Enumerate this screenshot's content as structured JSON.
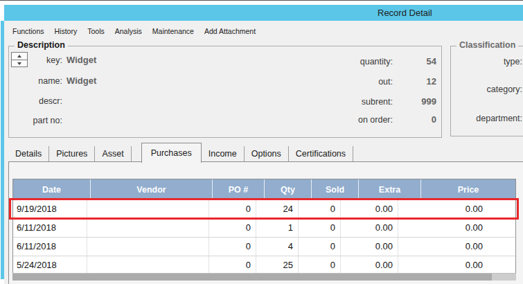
{
  "window": {
    "title": "Record Detail"
  },
  "menu": {
    "items": [
      "Functions",
      "History",
      "Tools",
      "Analysis",
      "Maintenance",
      "Add Attachment"
    ]
  },
  "description_panel": {
    "legend": "Description",
    "fields_left": [
      {
        "label": "key:",
        "value": "Widget"
      },
      {
        "label": "name:",
        "value": "Widget"
      },
      {
        "label": "descr:",
        "value": ""
      },
      {
        "label": "part no:",
        "value": ""
      }
    ],
    "fields_right": [
      {
        "label": "quantity:",
        "value": "54"
      },
      {
        "label": "out:",
        "value": "12"
      },
      {
        "label": "subrent:",
        "value": "999"
      },
      {
        "label": "on order:",
        "value": "0"
      }
    ]
  },
  "classification_panel": {
    "legend": "Classification",
    "fields": [
      {
        "label": "type:"
      },
      {
        "label": "category:"
      },
      {
        "label": "department:"
      }
    ]
  },
  "tabs": {
    "items": [
      "Details",
      "Pictures",
      "Asset",
      "Purchases",
      "Income",
      "Options",
      "Certifications"
    ],
    "selected": "Purchases"
  },
  "table": {
    "columns": [
      "Date",
      "Vendor",
      "PO #",
      "Qty",
      "Sold",
      "Extra",
      "Price"
    ],
    "rows": [
      [
        "9/19/2018",
        "",
        "0",
        "24",
        "0",
        "0.00",
        "0.00"
      ],
      [
        "6/11/2018",
        "",
        "0",
        "1",
        "0",
        "0.00",
        "0.00"
      ],
      [
        "6/11/2018",
        "",
        "0",
        "4",
        "0",
        "0.00",
        "0.00"
      ],
      [
        "5/24/2018",
        "",
        "0",
        "25",
        "0",
        "0.00",
        "0.00"
      ]
    ],
    "highlighted_row_index": 0
  },
  "colors": {
    "titlebar_blue": "#5BC6E8",
    "table_header_blue": "#92ADCD",
    "highlight_red": "#E8282C",
    "window_bg": "#F0F0F0"
  }
}
